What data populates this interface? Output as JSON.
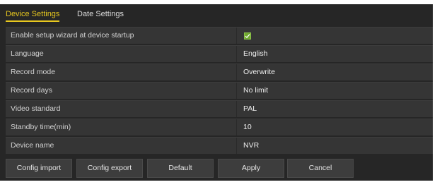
{
  "tabs": [
    {
      "label": "Device Settings",
      "active": true
    },
    {
      "label": "Date Settings",
      "active": false
    }
  ],
  "settings": [
    {
      "label": "Enable setup wizard at device startup",
      "value": "",
      "checked": true
    },
    {
      "label": "Language",
      "value": "English"
    },
    {
      "label": "Record mode",
      "value": "Overwrite"
    },
    {
      "label": "Record days",
      "value": "No limit"
    },
    {
      "label": "Video standard",
      "value": "PAL"
    },
    {
      "label": "Standby time(min)",
      "value": "10"
    },
    {
      "label": "Device name",
      "value": "NVR"
    }
  ],
  "buttons": {
    "config_import": "Config import",
    "config_export": "Config export",
    "default": "Default",
    "apply": "Apply",
    "cancel": "Cancel"
  },
  "colors": {
    "accent": "#e8c81f",
    "panel_bg": "#262626",
    "row_bg": "#353535",
    "checkbox": "#6fa82f"
  },
  "icons": {
    "checkbox": "checkmark-icon"
  }
}
